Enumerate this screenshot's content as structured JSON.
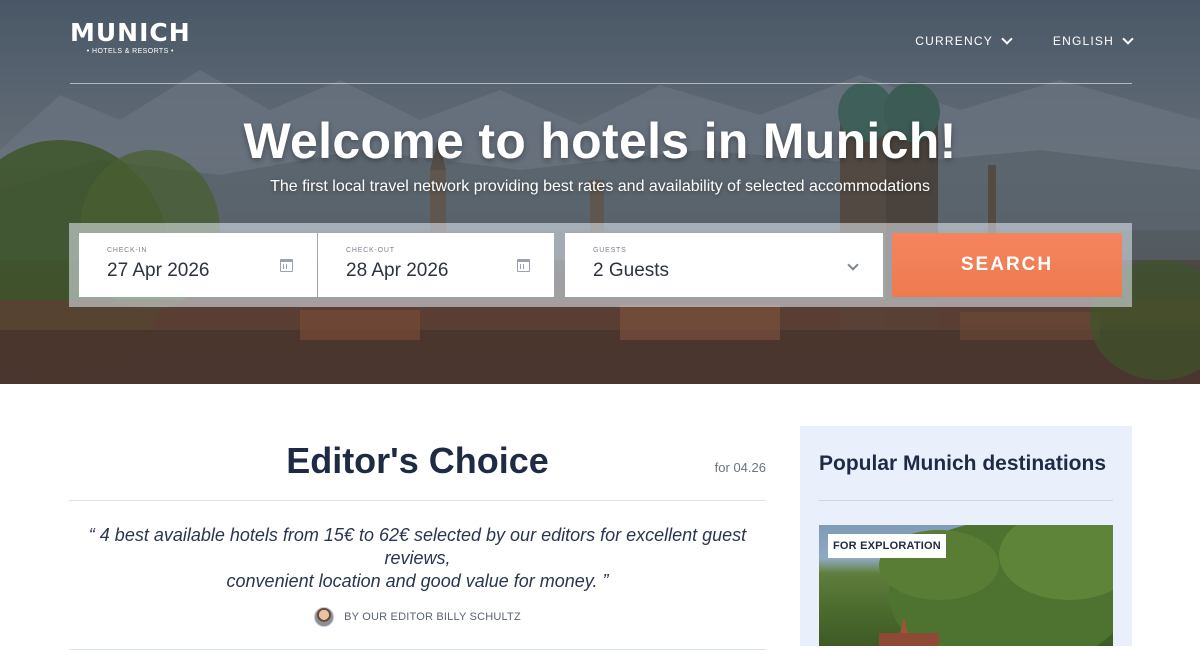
{
  "header": {
    "logo_main": "MUNICH",
    "logo_sub": "• HOTELS & RESORTS •",
    "nav": [
      {
        "label": "CURRENCY"
      },
      {
        "label": "ENGLISH"
      }
    ]
  },
  "hero": {
    "title": "Welcome to hotels in Munich!",
    "subtitle": "The first local travel network providing best rates and availability of selected accommodations"
  },
  "search": {
    "checkin": {
      "label": "CHECK-IN",
      "value": "27 Apr 2026",
      "icon": "calendar-icon"
    },
    "checkout": {
      "label": "CHECK-OUT",
      "value": "28 Apr 2026",
      "icon": "calendar-icon"
    },
    "guests": {
      "label": "GUESTS",
      "value": "2 Guests",
      "icon": "chevron-down-icon"
    },
    "button_label": "SEARCH",
    "button_color": "#f07c52"
  },
  "editors_choice": {
    "title": "Editor's Choice",
    "date": "for 04.26",
    "quote_line1": "“ 4 best available hotels from 15€ to 62€ selected by our editors for excellent guest reviews,",
    "quote_line2": "convenient location and good value for money. ”",
    "byline": "BY OUR EDITOR BILLY SCHULTZ"
  },
  "popular": {
    "title": "Popular Munich destinations",
    "card_badge": "FOR EXPLORATION",
    "panel_color": "#e9f0fb"
  },
  "colors": {
    "accent": "#f07c52",
    "heading": "#1f2a44"
  }
}
